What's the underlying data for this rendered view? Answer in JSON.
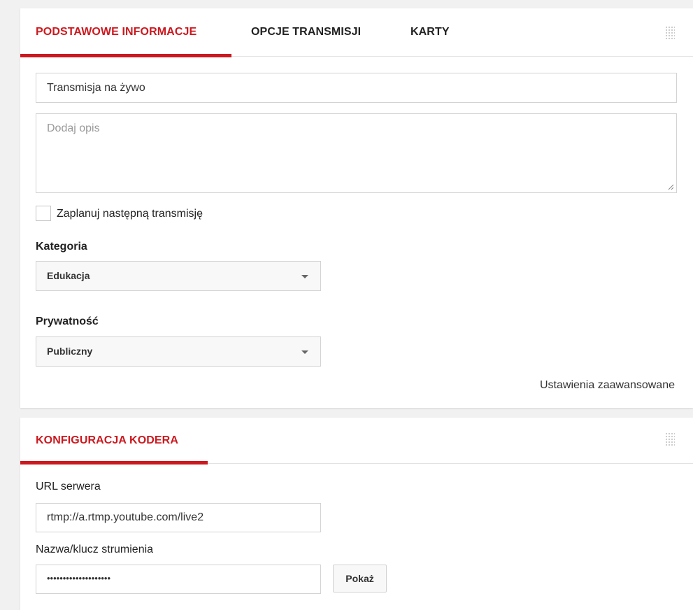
{
  "basic_card": {
    "tabs": [
      {
        "label": "PODSTAWOWE INFORMACJE",
        "active": true
      },
      {
        "label": "OPCJE TRANSMISJI",
        "active": false
      },
      {
        "label": "KARTY",
        "active": false
      }
    ],
    "title_field": {
      "value": "Transmisja na żywo"
    },
    "description_field": {
      "placeholder": "Dodaj opis"
    },
    "schedule_checkbox": {
      "label": "Zaplanuj następną transmisję",
      "checked": false
    },
    "category": {
      "label": "Kategoria",
      "selected": "Edukacja"
    },
    "privacy": {
      "label": "Prywatność",
      "selected": "Publiczny"
    },
    "advanced_settings_link": "Ustawienia zaawansowane"
  },
  "encoder_card": {
    "tab": {
      "label": "KONFIGURACJA KODERA",
      "active": true
    },
    "server_url": {
      "label": "URL serwera",
      "value": "rtmp://a.rtmp.youtube.com/live2"
    },
    "stream_key": {
      "label": "Nazwa/klucz strumienia",
      "value": "••••••••••••••••••••"
    },
    "show_button": "Pokaż"
  },
  "colors": {
    "accent": "#cc181e",
    "background": "#f1f1f1",
    "card": "#ffffff",
    "border": "#d3d3d3"
  },
  "icons": [
    "drag-handle-icon",
    "dropdown-caret-icon",
    "resize-handle-icon"
  ]
}
